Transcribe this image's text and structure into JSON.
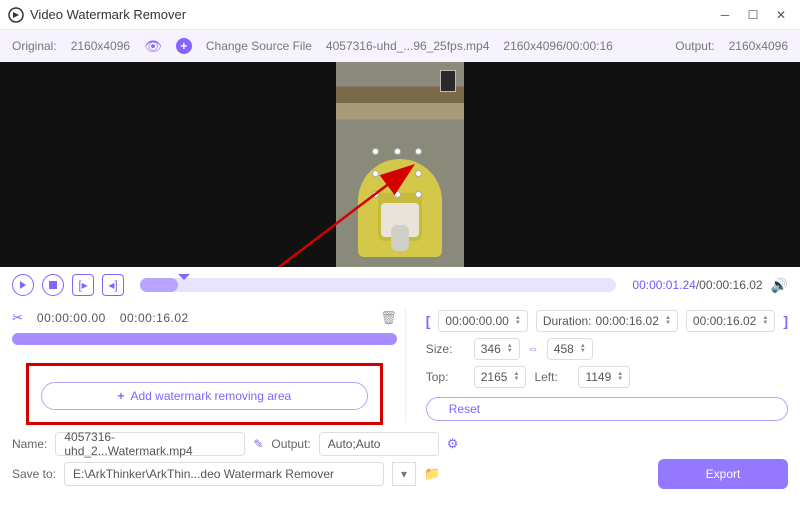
{
  "app": {
    "title": "Video Watermark Remover"
  },
  "info": {
    "original_lbl": "Original:",
    "original_res": "2160x4096",
    "change_src": "Change Source File",
    "file_info": "4057316-uhd_...96_25fps.mp4",
    "res_dur": "2160x4096/00:00:16",
    "output_lbl": "Output:",
    "output_res": "2160x4096"
  },
  "playback": {
    "current": "00:00:01.24",
    "total": "00:00:16.02"
  },
  "wm": {
    "start": "00:00:00.00",
    "end": "00:00:16.02",
    "add_btn": "Add watermark removing area"
  },
  "seg": {
    "start": "00:00:00.00",
    "dur_lbl": "Duration:",
    "dur": "00:00:16.02",
    "end": "00:00:16.02",
    "size_lbl": "Size:",
    "w": "346",
    "h": "458",
    "top_lbl": "Top:",
    "top": "2165",
    "left_lbl": "Left:",
    "left": "1149",
    "reset": "Reset"
  },
  "bottom": {
    "name_lbl": "Name:",
    "name_val": "4057316-uhd_2...Watermark.mp4",
    "output_lbl": "Output:",
    "output_val": "Auto;Auto",
    "save_lbl": "Save to:",
    "save_val": "E:\\ArkThinker\\ArkThin...deo Watermark Remover",
    "export": "Export"
  }
}
